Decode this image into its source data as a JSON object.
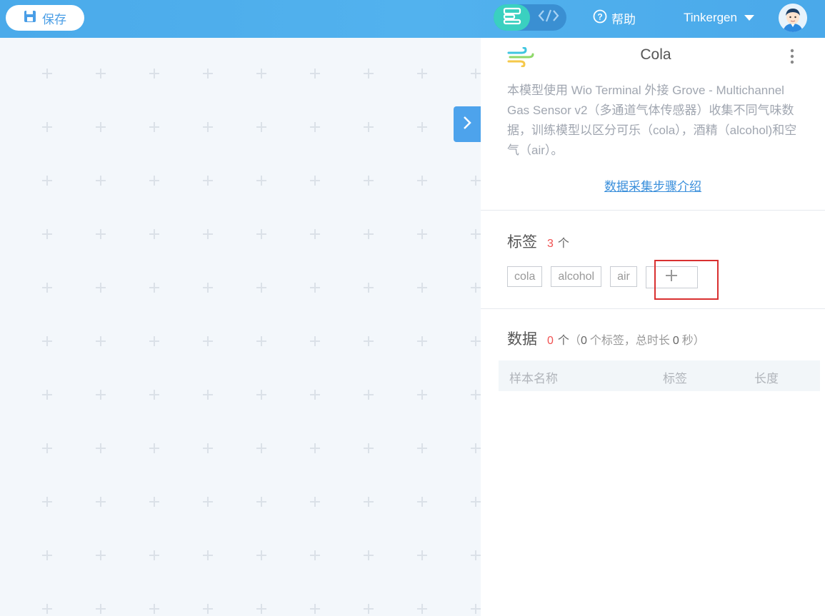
{
  "header": {
    "save_label": "保存",
    "help_label": "帮助",
    "username": "Tinkergen"
  },
  "model": {
    "title": "Cola",
    "description": "本模型使用 Wio Terminal 外接 Grove - Multichannel Gas Sensor v2（多通道气体传感器）收集不同气味数据，训练模型以区分可乐（cola），酒精（alcohol)和空气（air）。",
    "guide_link": "数据采集步骤介绍"
  },
  "labels_section": {
    "title": "标签",
    "count": "3",
    "unit": "个",
    "tags": [
      "cola",
      "alcohol",
      "air"
    ]
  },
  "data_section": {
    "title": "数据",
    "count": "0",
    "unit": "个",
    "paren_open": "（",
    "tag_count": "0",
    "tag_text": "个标签，总时长",
    "duration": "0",
    "duration_unit": "秒",
    "paren_close": "）"
  },
  "table": {
    "columns": [
      "样本名称",
      "标签",
      "长度"
    ]
  },
  "colors": {
    "header_blue": "#4aaaea",
    "accent_teal": "#3ad0c0",
    "count_red": "#f05050",
    "link_blue": "#3a8fdb",
    "highlight_red": "#d93030"
  },
  "icons": [
    "save-icon",
    "blocks-mode-icon",
    "code-mode-icon",
    "help-icon",
    "caret-down-icon",
    "avatar-icon",
    "chevron-right-icon",
    "gas-model-icon",
    "more-vertical-icon",
    "plus-icon"
  ]
}
